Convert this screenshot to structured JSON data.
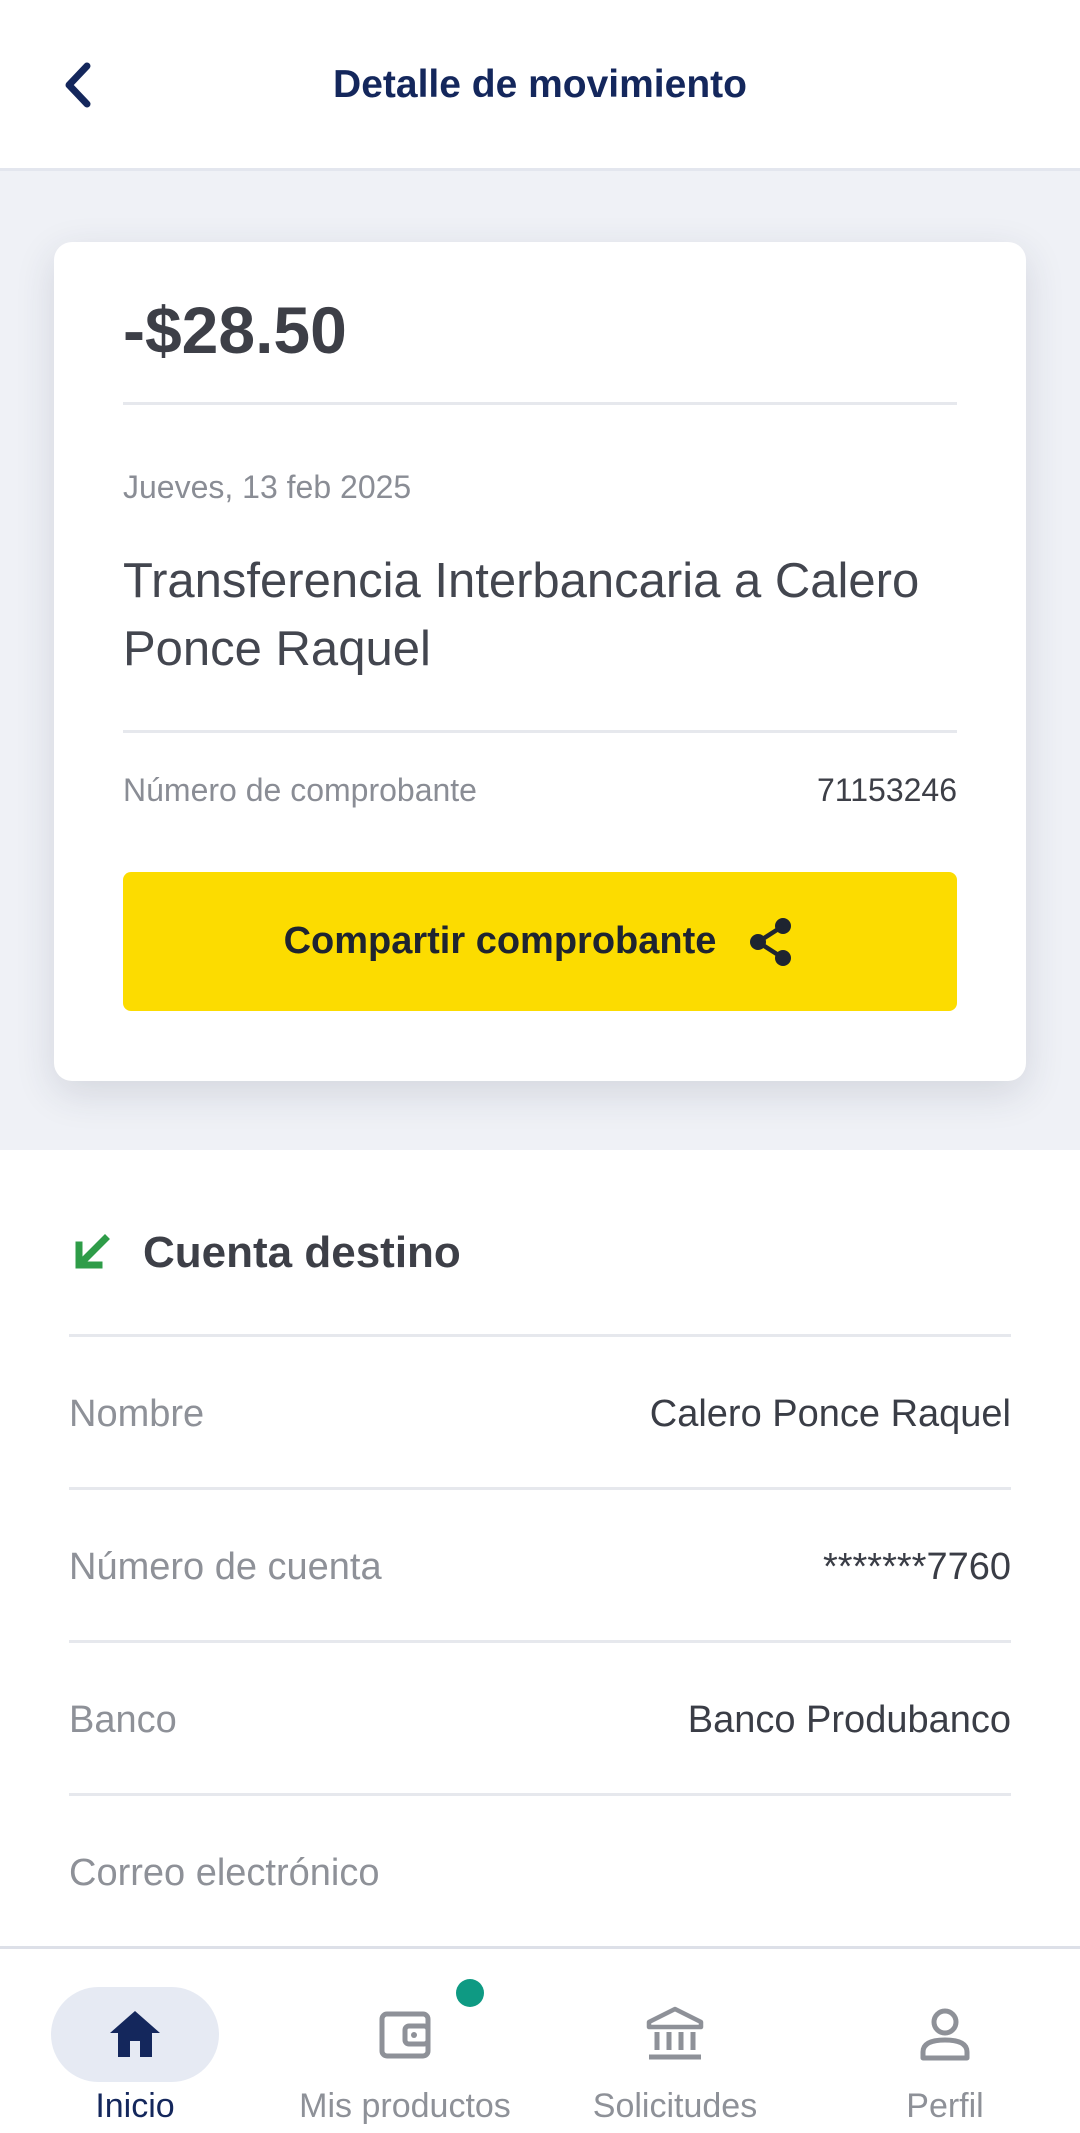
{
  "header": {
    "title": "Detalle de movimiento",
    "back_icon": "chevron-left-icon"
  },
  "colors": {
    "brand_navy": "#14275c",
    "accent_yellow": "#fcdc00",
    "incoming_green": "#2e9c48",
    "notification_teal": "#0e9a83"
  },
  "movement": {
    "amount": "-$28.50",
    "date": "Jueves, 13 feb 2025",
    "description": "Transferencia Interbancaria a Calero Ponce Raquel",
    "voucher_label": "Número de comprobante",
    "voucher_number": "71153246",
    "share_button_label": "Compartir comprobante",
    "share_icon": "share-icon"
  },
  "destination": {
    "title": "Cuenta destino",
    "icon": "arrow-down-left-icon",
    "rows": [
      {
        "label": "Nombre",
        "value": "Calero Ponce Raquel"
      },
      {
        "label": "Número de cuenta",
        "value": "*******7760"
      },
      {
        "label": "Banco",
        "value": "Banco Produbanco"
      },
      {
        "label": "Correo electrónico",
        "value": ""
      }
    ]
  },
  "bottom_nav": {
    "items": [
      {
        "label": "Inicio",
        "icon": "home-icon",
        "active": true
      },
      {
        "label": "Mis productos",
        "icon": "wallet-icon",
        "active": false,
        "notification": true
      },
      {
        "label": "Solicitudes",
        "icon": "bank-icon",
        "active": false
      },
      {
        "label": "Perfil",
        "icon": "person-icon",
        "active": false
      }
    ]
  }
}
